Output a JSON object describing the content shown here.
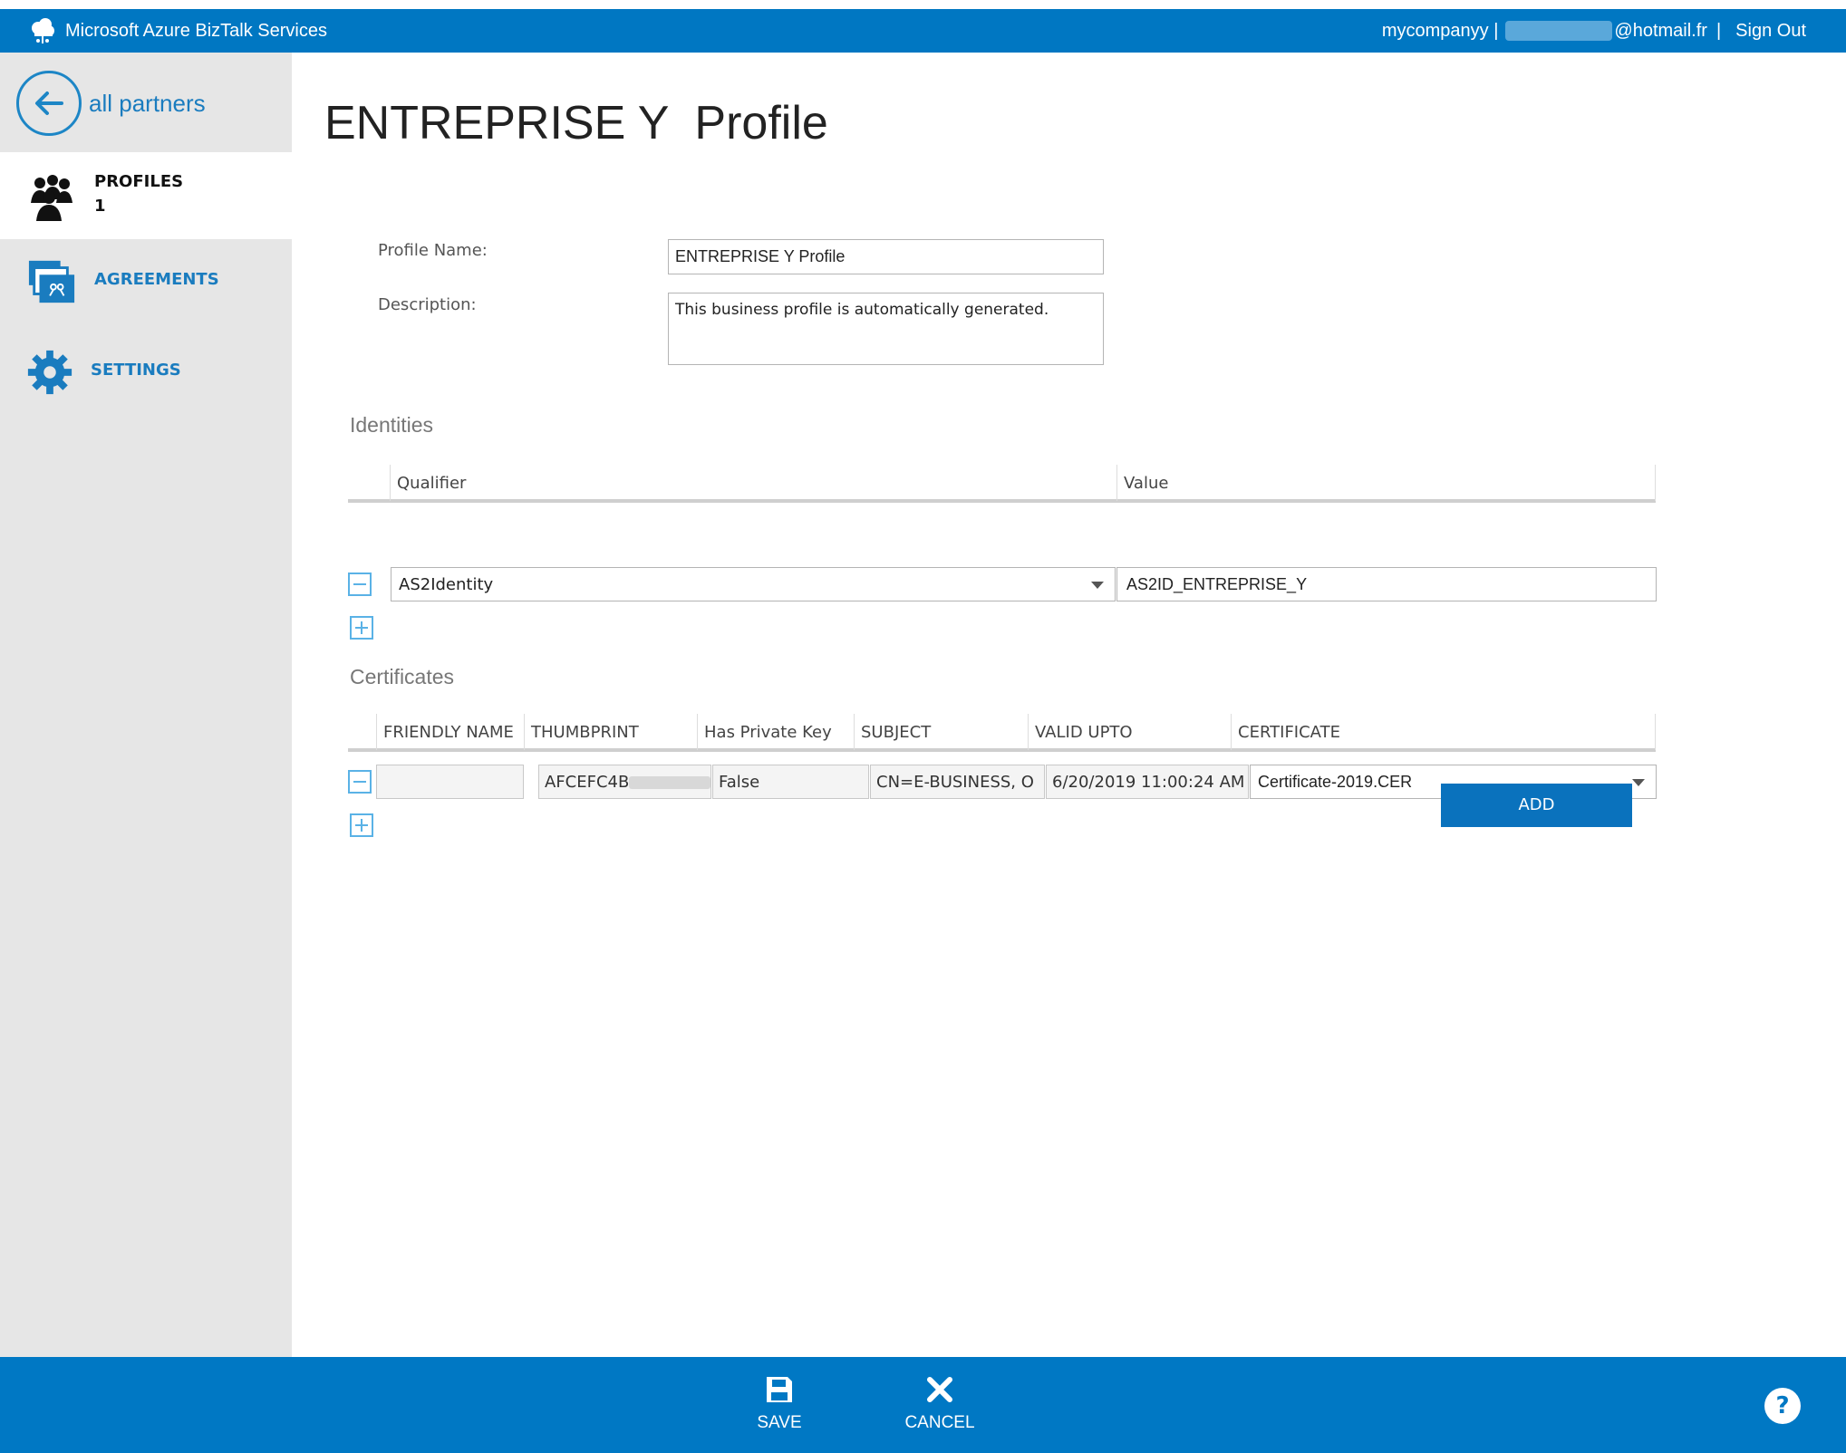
{
  "header": {
    "app_title": "Microsoft Azure BizTalk Services",
    "account": "mycompanyy |",
    "email_suffix": "@hotmail.fr",
    "separator": "|",
    "sign_out": "Sign Out"
  },
  "sidebar": {
    "back_label": "all partners",
    "items": [
      {
        "label": "PROFILES",
        "count": "1",
        "icon": "people-icon"
      },
      {
        "label": "AGREEMENTS",
        "icon": "agreements-icon"
      },
      {
        "label": "SETTINGS",
        "icon": "gear-icon"
      }
    ]
  },
  "page": {
    "title": "ENTREPRISE Y  Profile",
    "profile_name_label": "Profile Name:",
    "profile_name_value": "ENTREPRISE Y Profile",
    "description_label": "Description:",
    "description_value": "This business profile is automatically generated."
  },
  "identities": {
    "section_title": "Identities",
    "columns": [
      "Qualifier",
      "Value"
    ],
    "rows": [
      {
        "qualifier": "AS2Identity",
        "value": "AS2ID_ENTREPRISE_Y"
      }
    ]
  },
  "certificates": {
    "section_title": "Certificates",
    "columns": [
      "FRIENDLY NAME",
      "THUMBPRINT",
      "Has Private Key",
      "SUBJECT",
      "VALID UPTO",
      "CERTIFICATE"
    ],
    "rows": [
      {
        "friendly_name": "",
        "thumbprint": "AFCEFC4B",
        "has_private_key": "False",
        "subject": "CN=E-BUSINESS, O",
        "valid_upto": "6/20/2019 11:00:24 AM",
        "certificate": "Certificate-2019.CER"
      }
    ],
    "add_label": "ADD"
  },
  "footer": {
    "save_label": "SAVE",
    "cancel_label": "CANCEL",
    "help_label": "?"
  },
  "colors": {
    "header_blue": "#0077c2",
    "accent_blue": "#1a7cbf",
    "sidebar_gray": "#e6e6e6"
  }
}
